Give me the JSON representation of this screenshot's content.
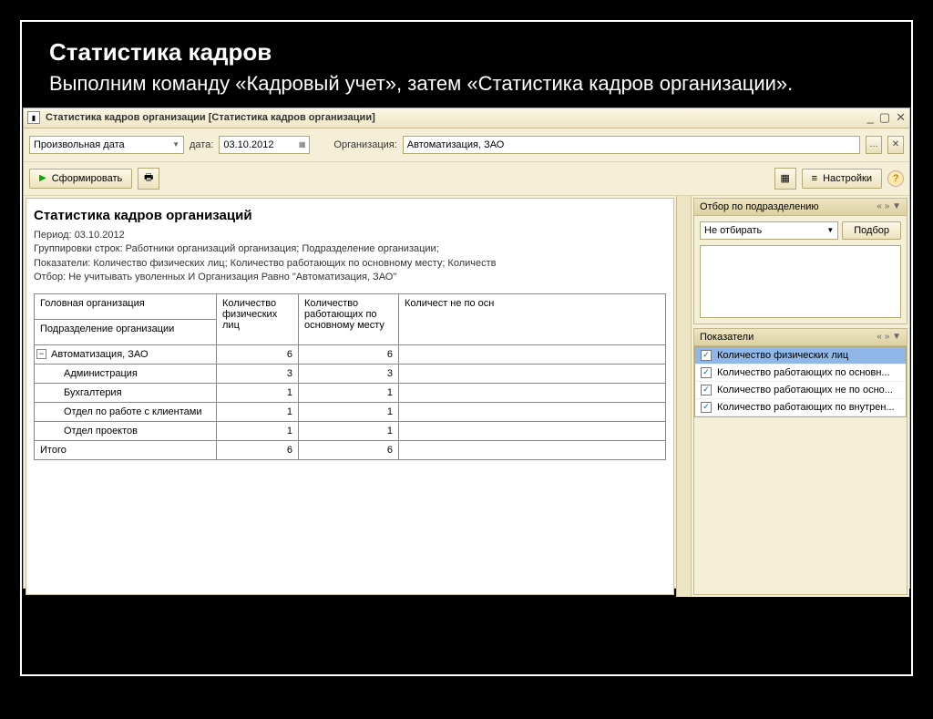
{
  "slide": {
    "title": "Статистика кадров",
    "subtitle": "Выполним команду «Кадровый учет», затем «Статистика кадров организации»."
  },
  "window": {
    "title": "Статистика кадров организации [Статистика кадров организации]"
  },
  "filters": {
    "period_type": "Произвольная дата",
    "date_label": "дата:",
    "date_value": "03.10.2012",
    "org_label": "Организация:",
    "org_value": "Автоматизация, ЗАО"
  },
  "toolbar": {
    "generate": "Сформировать",
    "settings": "Настройки"
  },
  "report": {
    "title": "Статистика кадров организаций",
    "period_line": "Период: 03.10.2012",
    "groupings_line": "Группировки строк: Работники организаций организация; Подразделение организации;",
    "indicators_line": "Показатели: Количество физических лиц; Количество работающих по основному месту; Количеств",
    "filter_line": "Отбор: Не учитывать уволенных И Организация Равно \"Автоматизация, ЗАО\"",
    "columns": {
      "org": "Головная организация",
      "dept": "Подразделение организации",
      "col1": "Количество физических лиц",
      "col2": "Количество работающих по основному месту",
      "col3": "Количест не по осн"
    },
    "rows": [
      {
        "label": "Автоматизация, ЗАО",
        "c1": "6",
        "c2": "6",
        "is_group": true
      },
      {
        "label": "Администрация",
        "c1": "3",
        "c2": "3"
      },
      {
        "label": "Бухгалтерия",
        "c1": "1",
        "c2": "1"
      },
      {
        "label": "Отдел по работе с клиентами",
        "c1": "1",
        "c2": "1"
      },
      {
        "label": "Отдел проектов",
        "c1": "1",
        "c2": "1"
      }
    ],
    "total_label": "Итого",
    "total_c1": "6",
    "total_c2": "6"
  },
  "side": {
    "dept_filter": {
      "title": "Отбор по подразделению",
      "mode": "Не отбирать",
      "pick": "Подбор"
    },
    "indicators": {
      "title": "Показатели",
      "items": [
        "Количество физических лиц",
        "Количество работающих по основн...",
        "Количество работающих не по осно...",
        "Количество работающих по внутрен..."
      ]
    }
  }
}
